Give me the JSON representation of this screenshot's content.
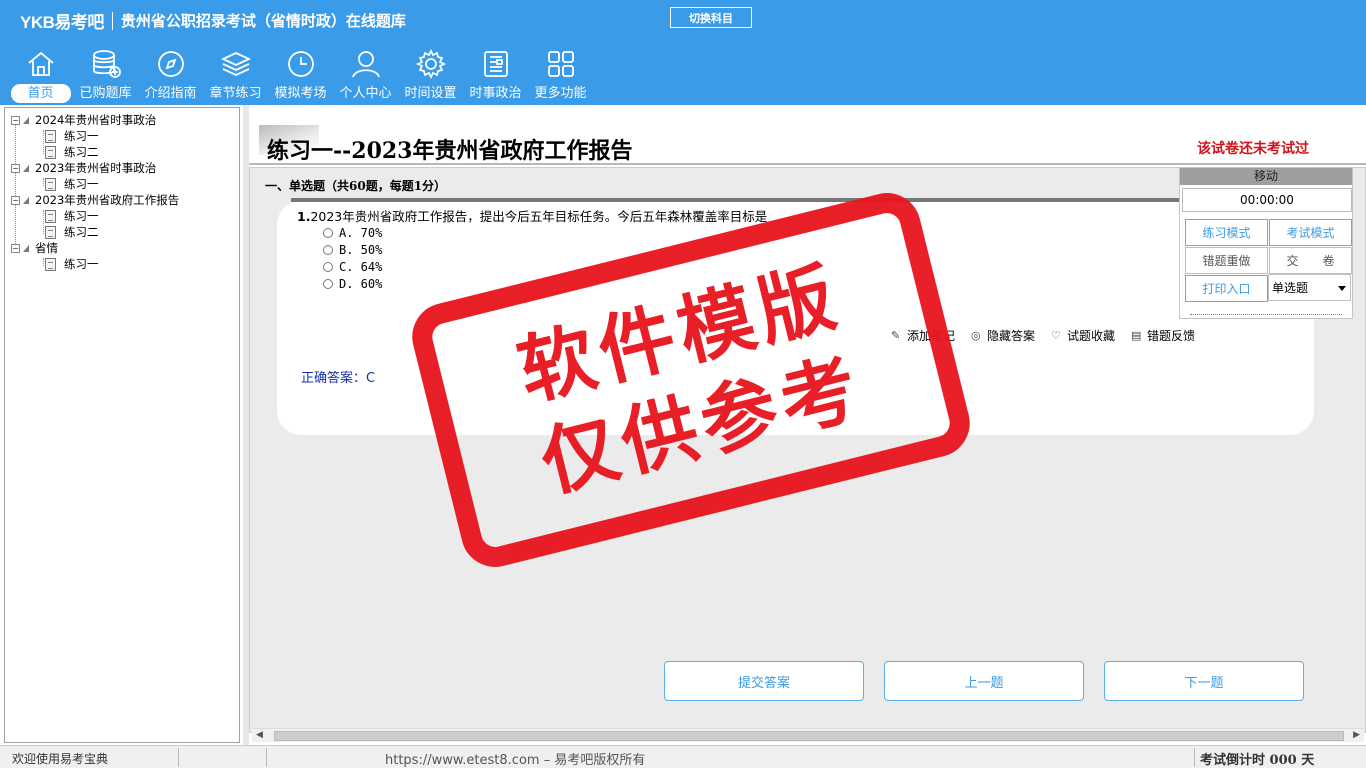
{
  "header": {
    "logo": "YKB易考吧",
    "title": "贵州省公职招录考试（省情时政）在线题库",
    "switch_label": "切换科目",
    "bg_color": "#3a9be8"
  },
  "nav": [
    {
      "label": "首页",
      "icon": "home-icon"
    },
    {
      "label": "已购题库",
      "icon": "database-add-icon"
    },
    {
      "label": "介绍指南",
      "icon": "compass-icon"
    },
    {
      "label": "章节练习",
      "icon": "layers-icon"
    },
    {
      "label": "模拟考场",
      "icon": "clock-icon"
    },
    {
      "label": "个人中心",
      "icon": "user-icon"
    },
    {
      "label": "时间设置",
      "icon": "gear-icon"
    },
    {
      "label": "时事政治",
      "icon": "newspaper-icon"
    },
    {
      "label": "更多功能",
      "icon": "grid-icon"
    }
  ],
  "tree": {
    "groups": [
      {
        "label": "2024年贵州省时事政治",
        "children": [
          "练习一",
          "练习二"
        ]
      },
      {
        "label": "2023年贵州省时事政治",
        "children": [
          "练习一"
        ]
      },
      {
        "label": "2023年贵州省政府工作报告",
        "children": [
          "练习一",
          "练习二"
        ]
      },
      {
        "label": "省情",
        "children": [
          "练习一"
        ]
      }
    ]
  },
  "paper": {
    "title": "练习一--2023年贵州省政府工作报告",
    "status": "该试卷还未考试过",
    "section": "一、单选题（共60题，每题1分）"
  },
  "question": {
    "number": "1.",
    "text": "2023年贵州省政府工作报告，提出今后五年目标任务。今后五年森林覆盖率目标是",
    "options": [
      "A. 70%",
      "B. 50%",
      "C. 64%",
      "D. 60%"
    ],
    "answer": "正确答案：C"
  },
  "tools": {
    "note": "添加笔记",
    "hide": "隐藏答案",
    "fav": "试题收藏",
    "report": "错题反馈"
  },
  "buttons": {
    "submit": "提交答案",
    "prev": "上一题",
    "next": "下一题"
  },
  "control": {
    "move": "移动",
    "timer": "00:00:00",
    "practice": "练习模式",
    "exam": "考试模式",
    "redo": "错题重做",
    "hand_in": "交　　卷",
    "print": "打印入口",
    "qtype": "单选题"
  },
  "stamp": {
    "line1": "软件模版",
    "line2": "仅供参考",
    "color": "#e8141d"
  },
  "status_bar": {
    "welcome": "欢迎使用易考宝典",
    "copyright": "https://www.etest8.com – 易考吧版权所有",
    "countdown": "考试倒计时 000 天"
  }
}
